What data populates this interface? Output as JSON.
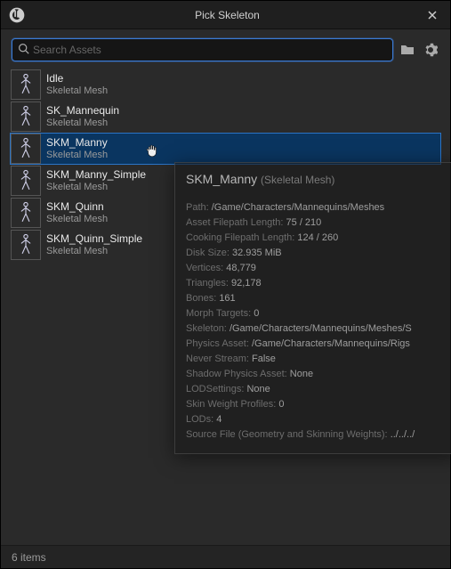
{
  "window": {
    "title": "Pick Skeleton"
  },
  "search": {
    "placeholder": "Search Assets",
    "value": ""
  },
  "items": [
    {
      "name": "Idle",
      "type": "Skeletal Mesh"
    },
    {
      "name": "SK_Mannequin",
      "type": "Skeletal Mesh"
    },
    {
      "name": "SKM_Manny",
      "type": "Skeletal Mesh"
    },
    {
      "name": "SKM_Manny_Simple",
      "type": "Skeletal Mesh"
    },
    {
      "name": "SKM_Quinn",
      "type": "Skeletal Mesh"
    },
    {
      "name": "SKM_Quinn_Simple",
      "type": "Skeletal Mesh"
    }
  ],
  "selected_index": 2,
  "footer": {
    "count_label": "6 items"
  },
  "tooltip": {
    "title": "SKM_Manny",
    "subtitle": "(Skeletal Mesh)",
    "rows": [
      {
        "k": "Path:",
        "v": "/Game/Characters/Mannequins/Meshes"
      },
      {
        "k": "Asset Filepath Length:",
        "v": "75 / 210"
      },
      {
        "k": "Cooking Filepath Length:",
        "v": "124 / 260"
      },
      {
        "k": "Disk Size:",
        "v": "32.935 MiB"
      },
      {
        "k": "Vertices:",
        "v": "48,779"
      },
      {
        "k": "Triangles:",
        "v": "92,178"
      },
      {
        "k": "Bones:",
        "v": "161"
      },
      {
        "k": "Morph Targets:",
        "v": "0"
      },
      {
        "k": "Skeleton:",
        "v": "/Game/Characters/Mannequins/Meshes/S"
      },
      {
        "k": "Physics Asset:",
        "v": "/Game/Characters/Mannequins/Rigs"
      },
      {
        "k": "Never Stream:",
        "v": "False"
      },
      {
        "k": "Shadow Physics Asset:",
        "v": "None"
      },
      {
        "k": "LODSettings:",
        "v": "None"
      },
      {
        "k": "Skin Weight Profiles:",
        "v": "0"
      },
      {
        "k": "LODs:",
        "v": "4"
      },
      {
        "k": "Source File (Geometry and Skinning Weights):",
        "v": "../../../"
      }
    ]
  }
}
